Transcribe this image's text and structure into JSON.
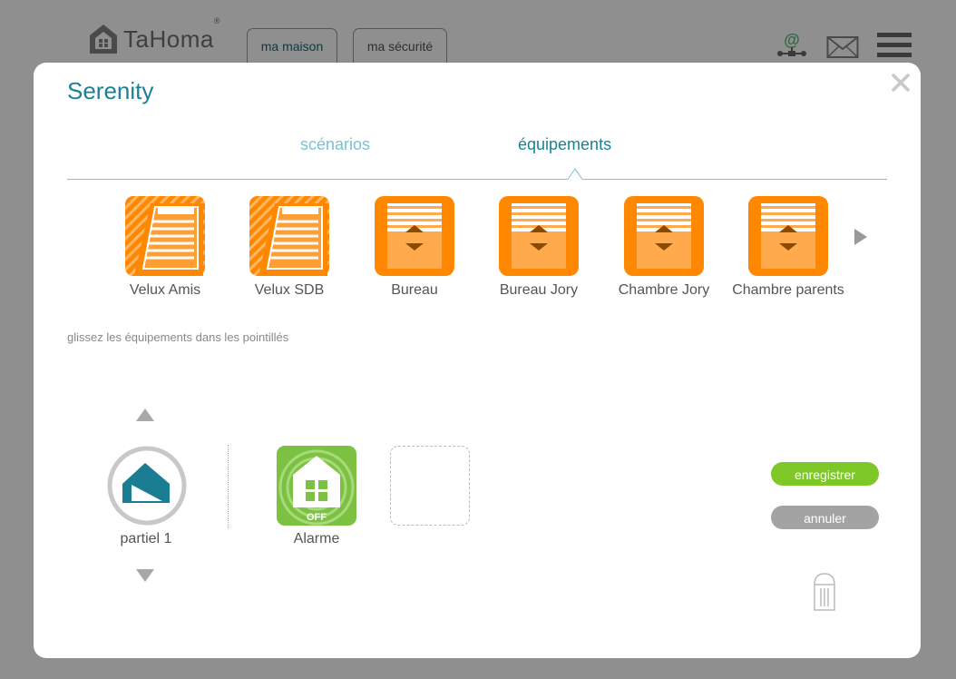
{
  "app": {
    "logo_text": "TaHoma",
    "logo_reg": "®",
    "tabs": [
      {
        "label": "ma maison"
      },
      {
        "label": "ma sécurité"
      }
    ],
    "header_icons": [
      "network-at-icon",
      "mail-icon",
      "menu-icon"
    ]
  },
  "modal": {
    "title": "Serenity",
    "tabs": [
      {
        "label": "scénarios",
        "active": false
      },
      {
        "label": "équipements",
        "active": true
      }
    ],
    "devices": [
      {
        "label": "Velux Amis",
        "icon": "velux-window-icon"
      },
      {
        "label": "Velux SDB",
        "icon": "velux-window-icon"
      },
      {
        "label": "Bureau",
        "icon": "roller-shutter-icon"
      },
      {
        "label": "Bureau Jory",
        "icon": "roller-shutter-icon"
      },
      {
        "label": "Chambre Jory",
        "icon": "roller-shutter-icon"
      },
      {
        "label": "Chambre parents",
        "icon": "roller-shutter-icon"
      }
    ],
    "hint": "glissez les équipements dans les pointillés",
    "mode": {
      "label": "partiel 1"
    },
    "slots": [
      {
        "label": "Alarme",
        "state": "OFF"
      }
    ],
    "buttons": {
      "save": "enregistrer",
      "cancel": "annuler"
    }
  },
  "colors": {
    "accent": "#1a8296",
    "tab_inactive": "#7cc2d2",
    "device_orange": "#ff8800",
    "alarm_green": "#7dc142",
    "save_green": "#7dc729",
    "cancel_grey": "#a3a3a3"
  }
}
